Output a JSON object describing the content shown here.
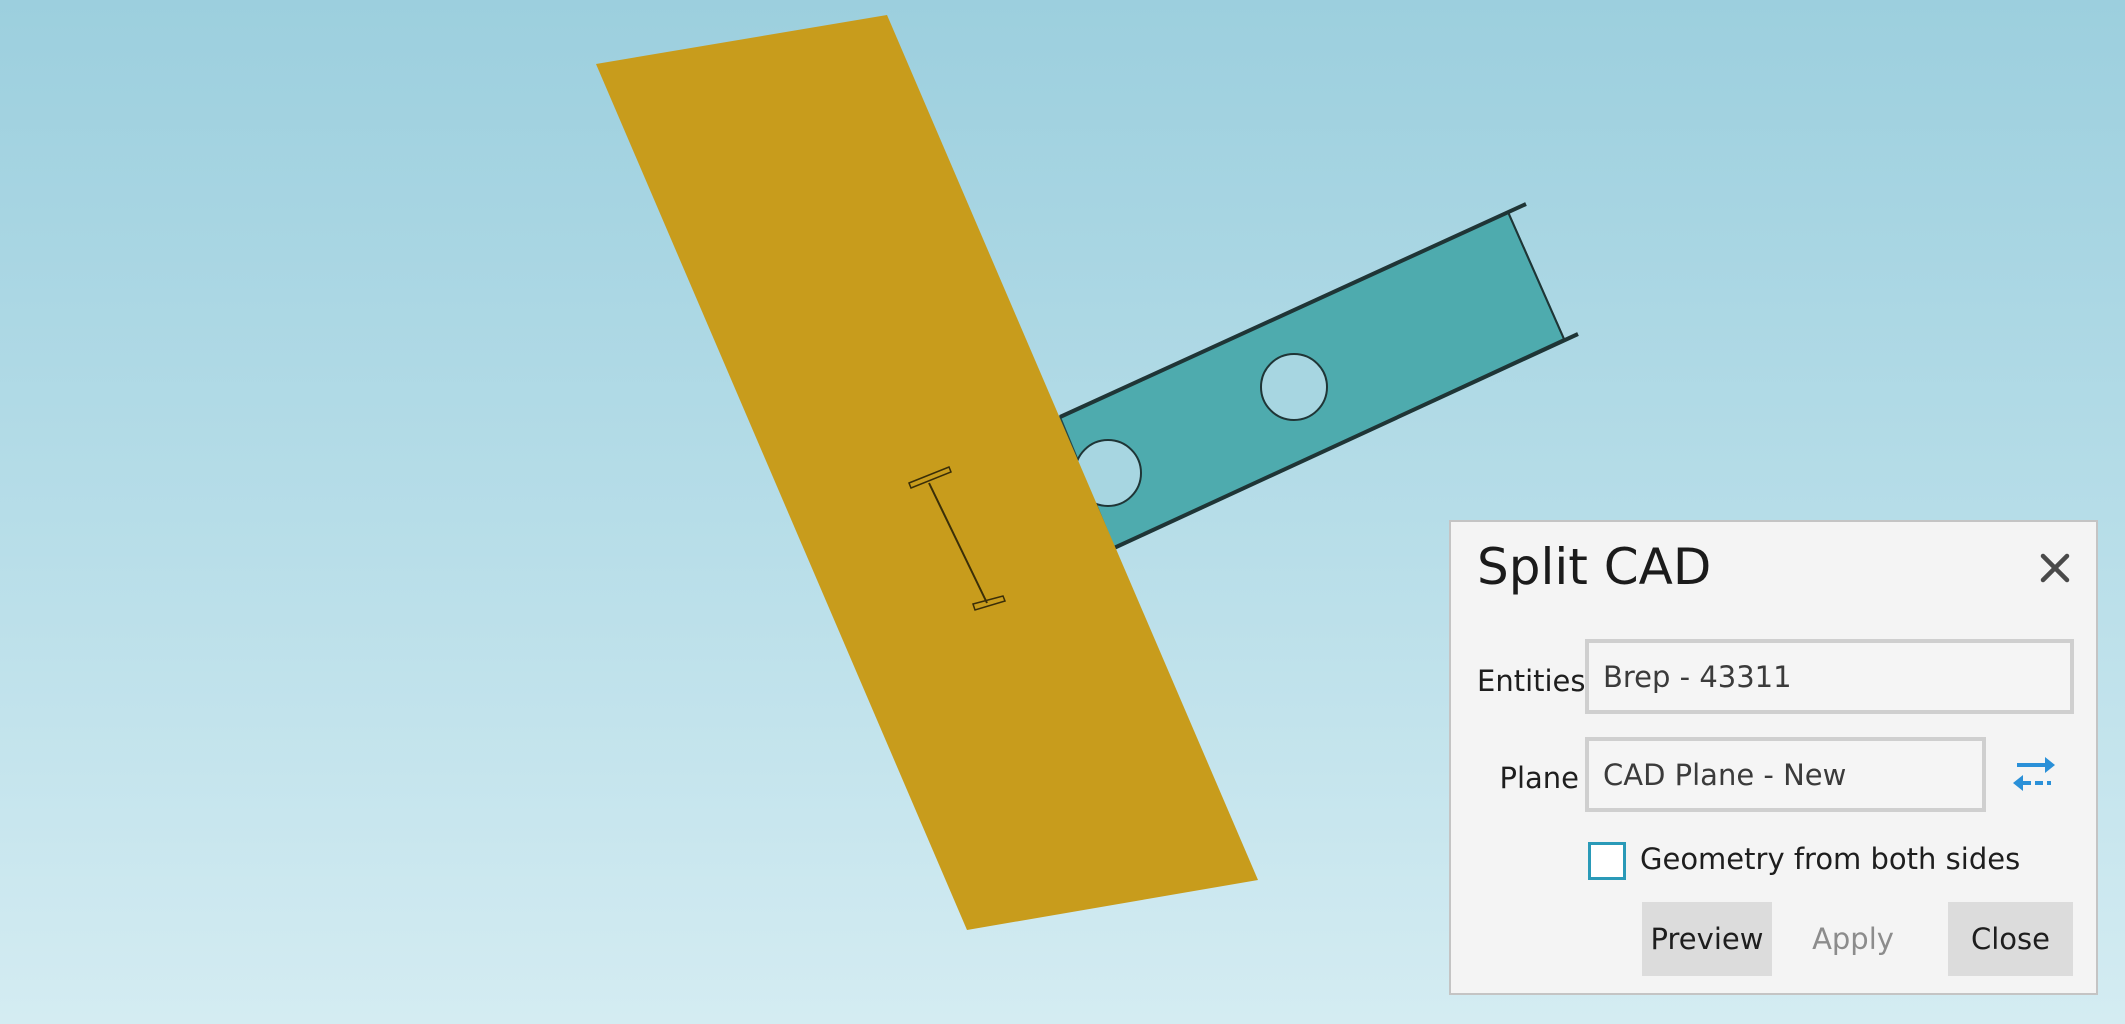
{
  "dialog": {
    "title": "Split CAD",
    "entities_label": "Entities",
    "entities_value": "Brep - 43311",
    "plane_label": "Plane",
    "plane_value": "CAD Plane - New",
    "checkbox_label": "Geometry from both sides",
    "checkbox_checked": false,
    "preview_label": "Preview",
    "apply_label": "Apply",
    "close_label": "Close"
  },
  "icons": {
    "close": "close-icon",
    "swap": "swap-direction-icon"
  },
  "colors": {
    "plate": "#c89c1c",
    "beam": "#4eabae",
    "accent": "#2a9ab8",
    "swap_icon": "#2a90d8"
  }
}
